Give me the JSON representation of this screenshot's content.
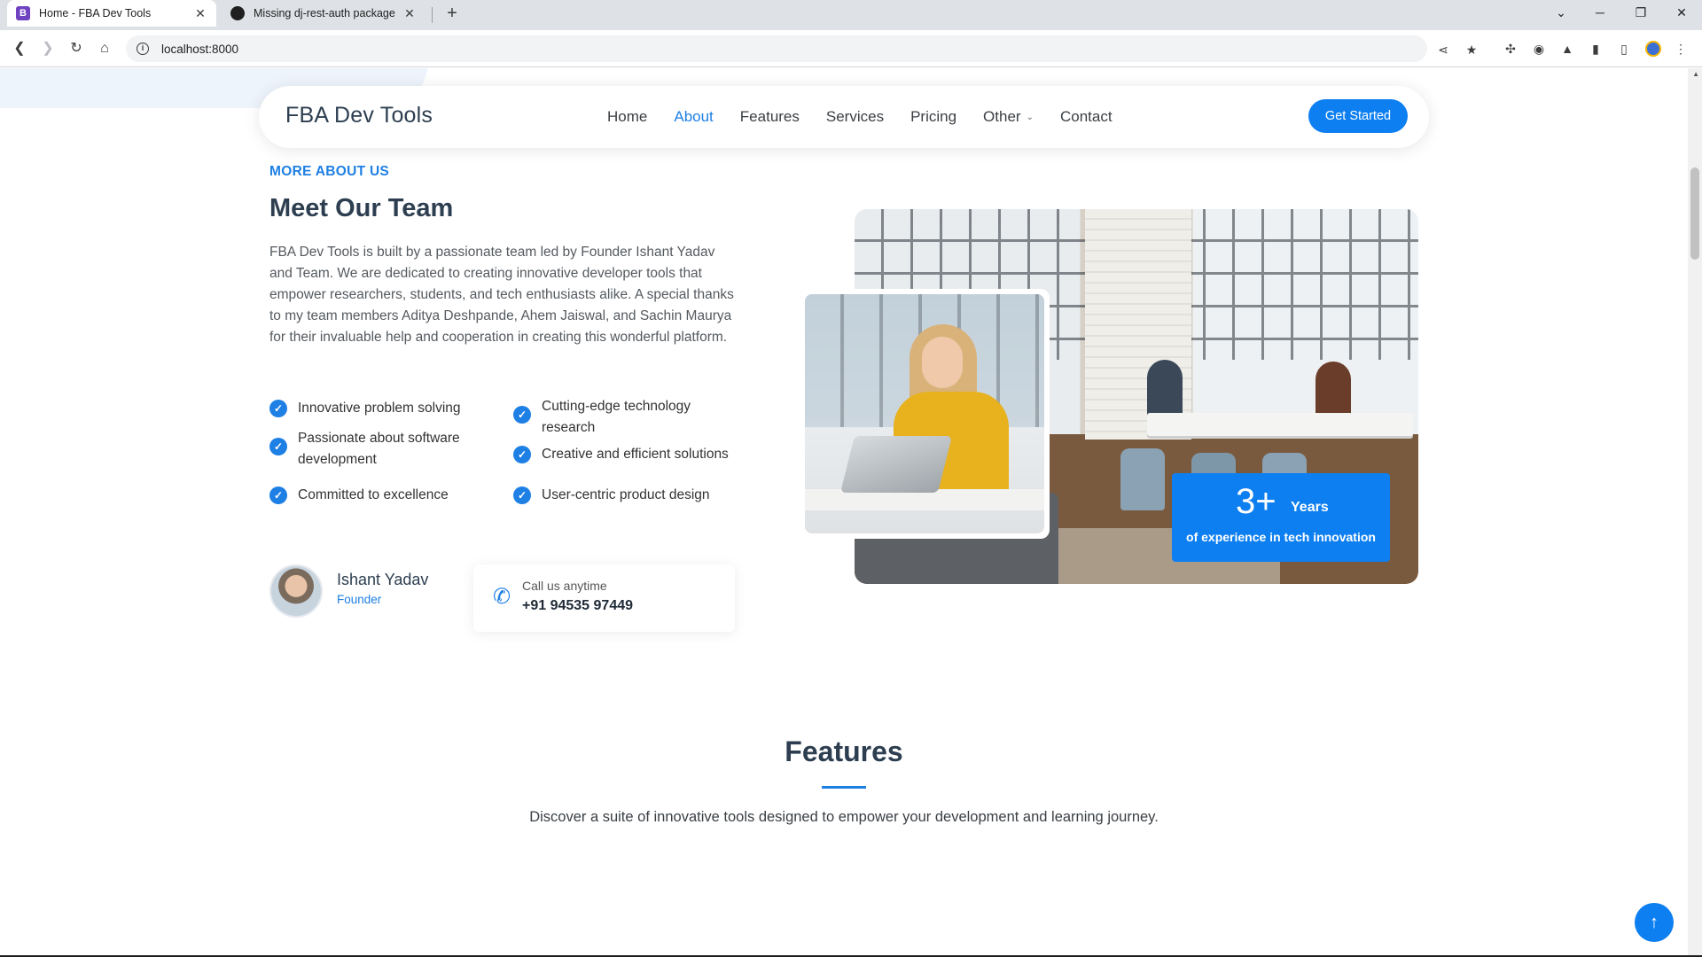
{
  "browser": {
    "tabs": [
      {
        "title": "Home - FBA Dev Tools",
        "favicon": "B",
        "active": true
      },
      {
        "title": "Missing dj-rest-auth package",
        "favicon": "github-icon",
        "active": false
      }
    ],
    "url": "localhost:8000",
    "window_controls": {
      "minimize": "─",
      "restore": "❐",
      "close": "✕",
      "tab_search": "⌄"
    },
    "new_tab_glyph": "+"
  },
  "nav": {
    "brand": "FBA Dev Tools",
    "links": [
      "Home",
      "About",
      "Features",
      "Services",
      "Pricing",
      "Other",
      "Contact"
    ],
    "active_link": "About",
    "cta": "Get Started",
    "accent_color": "#1e7fe4"
  },
  "about": {
    "eyebrow": "MORE ABOUT US",
    "title": "Meet Our Team",
    "description": "FBA Dev Tools is built by a passionate team led by Founder Ishant Yadav and Team. We are dedicated to creating innovative developer tools that empower researchers, students, and tech enthusiasts alike. A special thanks to my team members Aditya Deshpande, Ahem Jaiswal, and Sachin Maurya for their invaluable help and cooperation in creating this wonderful platform.",
    "features": [
      "Innovative problem solving",
      "Cutting-edge technology research",
      "Passionate about software development",
      "Creative and efficient solutions",
      "Committed to excellence",
      "User-centric product design"
    ],
    "founder": {
      "name": "Ishant Yadav",
      "role": "Founder"
    },
    "call": {
      "label": "Call us anytime",
      "number": "+91 94535 97449"
    },
    "experience": {
      "number": "3+",
      "unit": "Years",
      "text": "of experience in tech innovation"
    }
  },
  "features_section": {
    "title": "Features",
    "description": "Discover a suite of innovative tools designed to empower your development and learning journey."
  },
  "scroll_top_glyph": "↑"
}
